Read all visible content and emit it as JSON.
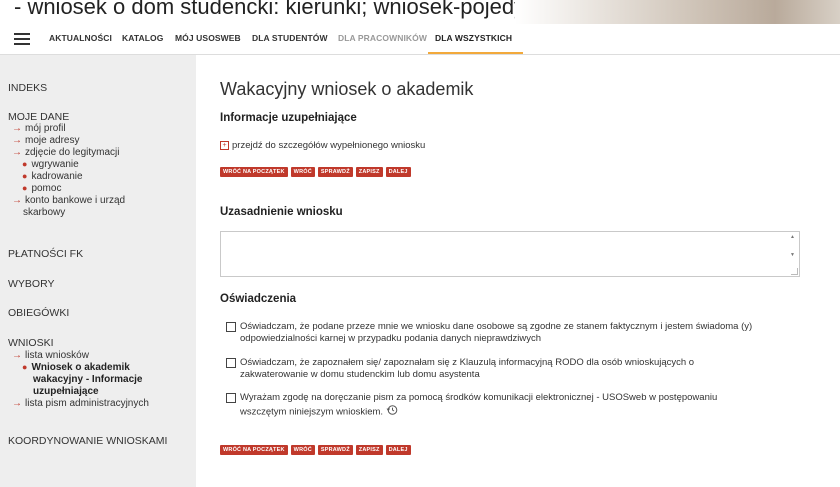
{
  "caption": {
    "text": "- wniosek o dom studencki: kierunki; wniosek-pojedynczy „Wniosek o akademik"
  },
  "nav": {
    "menu_icon": "hamburger-icon",
    "items": [
      {
        "label": "AKTUALNOŚCI"
      },
      {
        "label": "KATALOG"
      },
      {
        "label": "MÓJ USOSWEB"
      },
      {
        "label": "DLA STUDENTÓW"
      },
      {
        "label": "DLA PRACOWNIKÓW"
      },
      {
        "label": "DLA WSZYSTKICH"
      }
    ],
    "active_index": 5,
    "accent_color": "#f2a93b"
  },
  "sidebar": {
    "sections": [
      {
        "label": "INDEKS"
      },
      {
        "label": "MOJE DANE"
      },
      {
        "label": "PŁATNOŚCI FK"
      },
      {
        "label": "WYBORY"
      },
      {
        "label": "OBIEGÓWKI"
      },
      {
        "label": "WNIOSKI"
      },
      {
        "label": "KOORDYNOWANIE WNIOSKAMI"
      }
    ],
    "moje_dane_links": [
      {
        "label": "mój profil"
      },
      {
        "label": "moje adresy"
      },
      {
        "label": "zdjęcie do legitymacji"
      },
      {
        "label": "konto bankowe i urząd"
      },
      {
        "label": "skarbowy"
      }
    ],
    "zdjecie_sub": [
      {
        "label": "wgrywanie"
      },
      {
        "label": "kadrowanie"
      },
      {
        "label": "pomoc"
      }
    ],
    "wnioski_links": [
      {
        "label": "lista wniosków"
      },
      {
        "label": "lista pism administracyjnych"
      }
    ],
    "wnioski_current": [
      "Wniosek o akademik",
      "wakacyjny - Informacje",
      "uzupełniające"
    ],
    "bullet_color": "#c0392b"
  },
  "main": {
    "title": "Wakacyjny wniosek o akademik",
    "info_heading": "Informacje uzupełniające",
    "expand_label": "przejdź do szczegółów wypełnionego wniosku",
    "buttons": [
      {
        "label": "WRÓĆ NA POCZĄTEK"
      },
      {
        "label": "WRÓĆ"
      },
      {
        "label": "SPRAWDŹ"
      },
      {
        "label": "ZAPISZ"
      },
      {
        "label": "DALEJ"
      }
    ],
    "button_color": "#c0392b",
    "justification_heading": "Uzasadnienie wniosku",
    "justification_value": "",
    "declarations_heading": "Oświadczenia",
    "declarations": [
      {
        "line1": "Oświadczam, że podane przeze mnie we wniosku dane osobowe są zgodne ze stanem faktycznym i jestem świadoma (y)",
        "line2": "odpowiedzialności karnej w przypadku podania danych nieprawdziwych",
        "checked": false
      },
      {
        "line1": "Oświadczam, że zapoznałem się/ zapoznałam się z Klauzulą informacyjną RODO dla osób wnioskujących o",
        "line2": "zakwaterowanie w domu studenckim lub domu asystenta",
        "checked": false
      },
      {
        "line1": "Wyrażam zgodę na doręczanie pism za pomocą środków komunikacji elektronicznej - USOSweb w postępowaniu",
        "line2": "wszczętym niniejszym wnioskiem.",
        "checked": false
      }
    ]
  }
}
